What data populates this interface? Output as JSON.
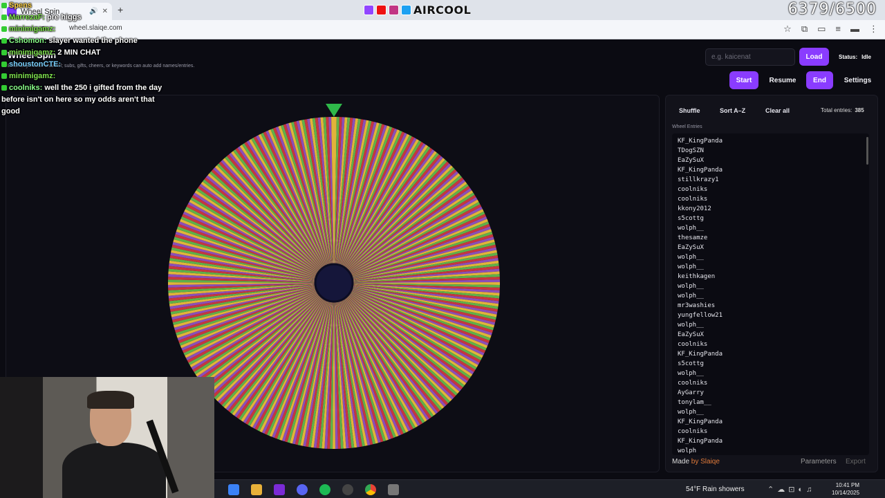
{
  "browser": {
    "tab_title": "Wheel Spin",
    "url": "wheel.slaiqe.com",
    "overlay_brand": "AIRCOOL",
    "overlay_counter": "6379/6500"
  },
  "app": {
    "title": "Wheel Spin",
    "subtitle": "Enter any Twitch channel; subs, gifts, cheers, or keywords can auto add names/entries.",
    "search_placeholder": "e.g. kaicenat",
    "load_label": "Load",
    "status_label": "Status:",
    "status_value": "Idle",
    "start_label": "Start",
    "resume_label": "Resume",
    "end_label": "End",
    "settings_label": "Settings"
  },
  "sidebar": {
    "shuffle_label": "Shuffle",
    "sort_label": "Sort A–Z",
    "clear_label": "Clear all",
    "total_label": "Total entries:",
    "total_value": "385",
    "entries_label": "Wheel Entries",
    "entries": [
      "KF_KingPanda",
      "TDogSZN",
      "EaZySuX",
      "KF_KingPanda",
      "stillkrazy1",
      "coolniks",
      "coolniks",
      "kkony2012",
      "s5cottg",
      "wolph__",
      "thesamze",
      "EaZySuX",
      "wolph__",
      "wolph__",
      "keithkagen",
      "wolph__",
      "wolph__",
      "mr3washies",
      "yungfellow21",
      "wolph__",
      "EaZySuX",
      "coolniks",
      "KF_KingPanda",
      "s5cottg",
      "wolph__",
      "coolniks",
      "AyGarry",
      "tonylam__",
      "wolph__",
      "KF_KingPanda",
      "coolniks",
      "KF_KingPanda",
      "wolph"
    ],
    "made_prefix": "Made",
    "made_by": "by Slaiqe",
    "parameters_label": "Parameters",
    "export_label": "Export"
  },
  "wheel": {
    "segment_count": 385,
    "colors": [
      "#e2b33a",
      "#5fb04a",
      "#c7373d",
      "#8c4fb8"
    ],
    "hub_color": "#15163a",
    "pointer_color": "#2fb84a"
  },
  "chat": [
    {
      "user": "Spens",
      "text": "",
      "cls": "u1"
    },
    {
      "user": "MarrezaF:",
      "text": "pre higgs",
      "cls": "u2"
    },
    {
      "user": "minimigamz:",
      "text": "",
      "cls": "u2"
    },
    {
      "user": "Cshomon:",
      "text": "slayer wanted the phone",
      "cls": "u4"
    },
    {
      "user": "minimigamz:",
      "text": "2 MIN CHAT",
      "cls": "u2"
    },
    {
      "user": "shoustonCTE:",
      "text": "",
      "cls": "u3"
    },
    {
      "user": "minimigamz:",
      "text": "",
      "cls": "u2"
    },
    {
      "user": "coolniks:",
      "text": "well the 250 i gifted from the day before isn't on here so my odds aren't that good",
      "cls": "u4"
    }
  ],
  "taskbar": {
    "weather": "54°F  Rain showers",
    "time": "10:41 PM",
    "date": "10/14/2025"
  }
}
